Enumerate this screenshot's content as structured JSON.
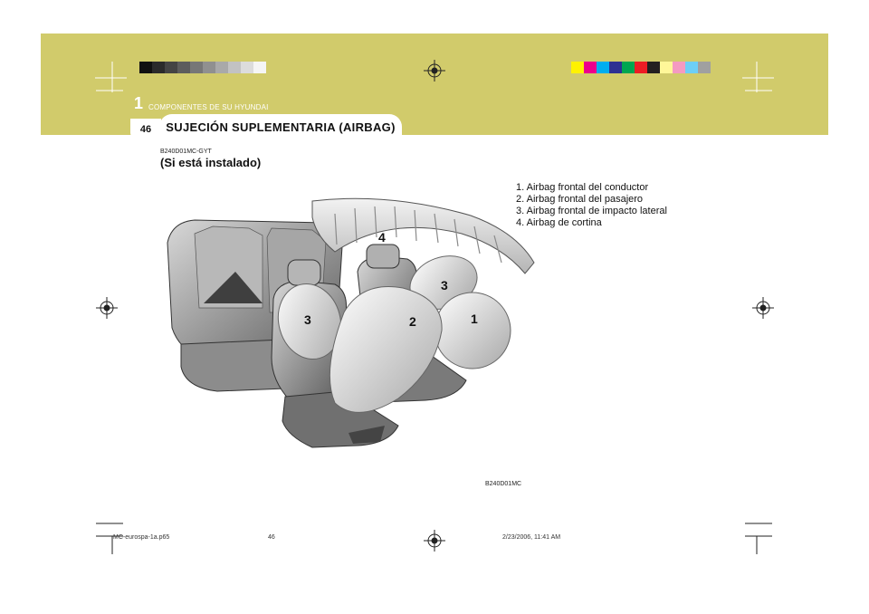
{
  "chapter": {
    "number": "1",
    "title": "COMPONENTES DE SU HYUNDAI"
  },
  "page_number": "46",
  "section_title": "SUJECIÓN SUPLEMENTARIA (AIRBAG)",
  "doc_code": "B240D01MC-GYT",
  "subtitle": "(Si está instalado)",
  "legend": [
    "1. Airbag frontal del conductor",
    "2. Airbag frontal del pasajero",
    "3. Airbag frontal de impacto lateral",
    "4. Airbag de cortina"
  ],
  "figure": {
    "code": "B240D01MC",
    "callouts": [
      "1",
      "2",
      "3",
      "3",
      "4"
    ]
  },
  "footer": {
    "file": "MC-eurospa-1a.p65",
    "page": "46",
    "date": "2/23/2006, 11:41 AM"
  },
  "colors": {
    "band": "#d1cb6b",
    "gray_bar": [
      "#111111",
      "#2b2b2b",
      "#444444",
      "#5d5d5d",
      "#777777",
      "#909090",
      "#a9a9a9",
      "#c2c2c2",
      "#dcdcdc",
      "#f5f5f5"
    ],
    "color_bar": [
      "#fff200",
      "#ec008c",
      "#00aeef",
      "#2e3192",
      "#00a651",
      "#ed1c24",
      "#231f20",
      "#fff799",
      "#f49ac1",
      "#6dcff6",
      "#a0a0a0"
    ]
  }
}
